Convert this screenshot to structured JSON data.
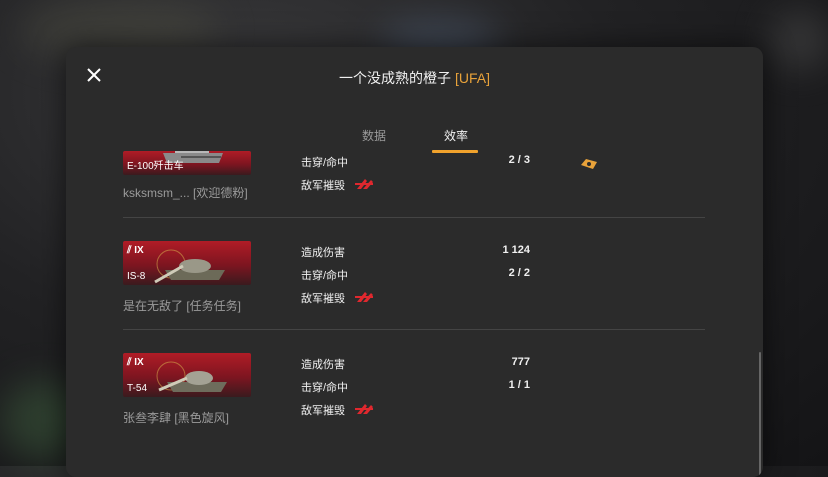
{
  "header": {
    "player_name": "一个没成熟的橙子",
    "clan_tag": "[UFA]"
  },
  "tabs": [
    {
      "label": "数据",
      "active": false
    },
    {
      "label": "效率",
      "active": true
    }
  ],
  "colors": {
    "accent": "#f0a22c",
    "card_red": "#b01c26",
    "destroy_red": "#e0282e",
    "muted_text": "#9b9b9b"
  },
  "rows": [
    {
      "tier": "",
      "tank": "E-100歼击车",
      "player": "ksksmsm_... [欢迎德粉]",
      "stats": [
        {
          "label": "击穿/命中",
          "value": "2 / 3"
        },
        {
          "label": "敌军摧毁",
          "value": ""
        }
      ],
      "badge_icon": "medal-badge-icon"
    },
    {
      "tier": "IX",
      "tank": "IS-8",
      "player": "是在无敌了 [任务任务]",
      "stats": [
        {
          "label": "造成伤害",
          "value": "1 124"
        },
        {
          "label": "击穿/命中",
          "value": "2 / 2"
        },
        {
          "label": "敌军摧毁",
          "value": ""
        }
      ]
    },
    {
      "tier": "IX",
      "tank": "T-54",
      "player": "张叁李肆 [黑色旋风]",
      "stats": [
        {
          "label": "造成伤害",
          "value": "777"
        },
        {
          "label": "击穿/命中",
          "value": "1 / 1"
        },
        {
          "label": "敌军摧毁",
          "value": ""
        }
      ]
    }
  ]
}
